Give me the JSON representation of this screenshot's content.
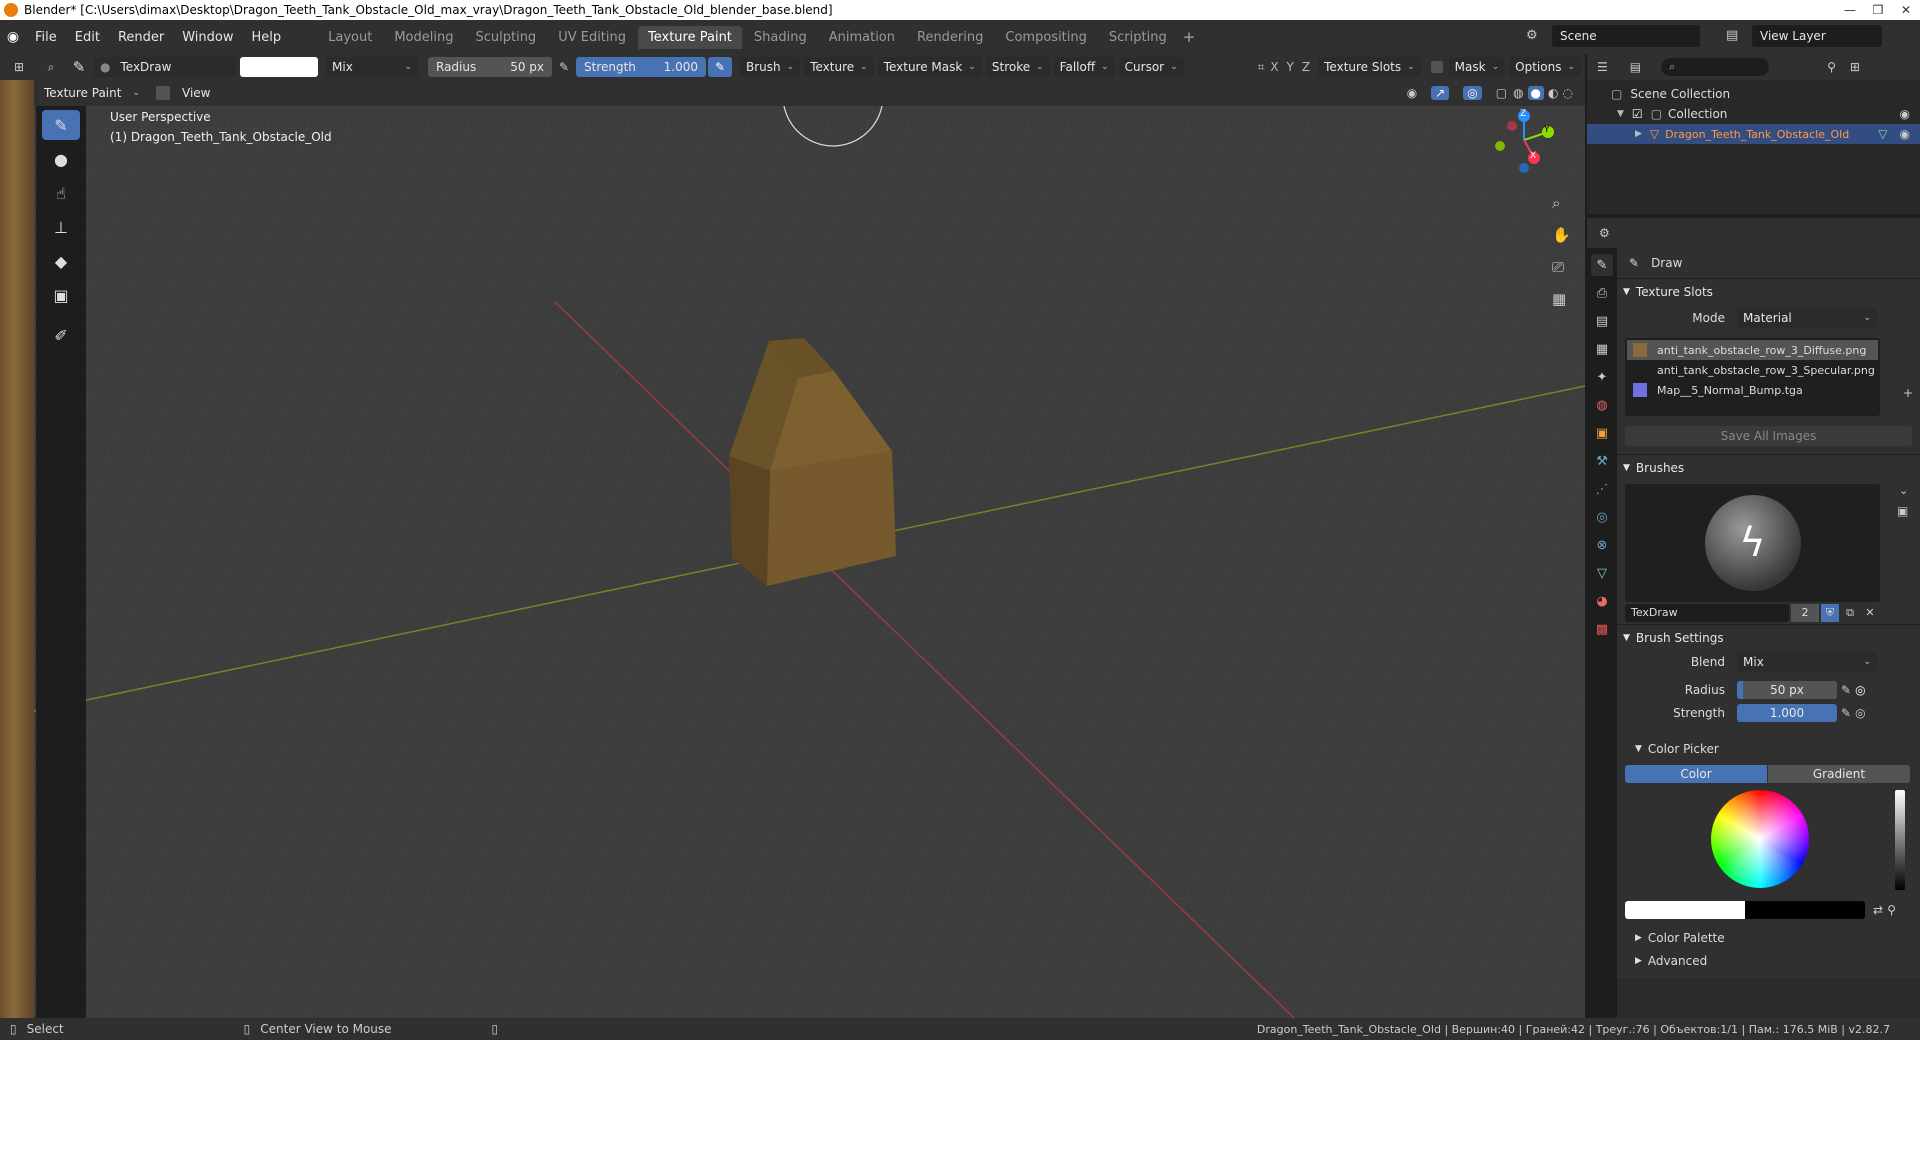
{
  "window": {
    "title": "Blender* [C:\\Users\\dimax\\Desktop\\Dragon_Teeth_Tank_Obstacle_Old_max_vray\\Dragon_Teeth_Tank_Obstacle_Old_blender_base.blend]",
    "buttons": [
      "—",
      "❐",
      "✕"
    ]
  },
  "menu": [
    "File",
    "Edit",
    "Render",
    "Window",
    "Help"
  ],
  "workspaces": [
    "Layout",
    "Modeling",
    "Sculpting",
    "UV Editing",
    "Texture Paint",
    "Shading",
    "Animation",
    "Rendering",
    "Compositing",
    "Scripting"
  ],
  "active_workspace": "Texture Paint",
  "scene": {
    "label": "Scene",
    "view_layer": "View Layer"
  },
  "header": {
    "brush_name": "TexDraw",
    "blend": "Mix",
    "radius_label": "Radius",
    "radius_value": "50 px",
    "strength_label": "Strength",
    "strength_value": "1.000",
    "menus": [
      "Brush",
      "Texture",
      "Texture Mask",
      "Stroke",
      "Falloff",
      "Cursor"
    ],
    "axes": [
      "X",
      "Y",
      "Z"
    ],
    "texture_slots": "Texture Slots",
    "mask": "Mask",
    "options": "Options"
  },
  "subheader": {
    "mode": "Texture Paint",
    "view": "View"
  },
  "viewport": {
    "perspective": "User Perspective",
    "object_label": "(1) Dragon_Teeth_Tank_Obstacle_Old",
    "gizmo": {
      "x": "X",
      "y": "Y",
      "z": "Z"
    }
  },
  "outliner": {
    "root": "Scene Collection",
    "collection": "Collection",
    "object": "Dragon_Teeth_Tank_Obstacle_Old"
  },
  "properties": {
    "tool": "Draw",
    "texture_slots": {
      "title": "Texture Slots",
      "mode_label": "Mode",
      "mode_value": "Material",
      "items": [
        "anti_tank_obstacle_row_3_Diffuse.png",
        "anti_tank_obstacle_row_3_Specular.png",
        "Map__5_Normal_Bump.tga"
      ],
      "save_all": "Save All Images"
    },
    "brushes": {
      "title": "Brushes",
      "name": "TexDraw",
      "users": "2"
    },
    "brush_settings": {
      "title": "Brush Settings",
      "blend_label": "Blend",
      "blend_value": "Mix",
      "radius_label": "Radius",
      "radius_value": "50 px",
      "strength_label": "Strength",
      "strength_value": "1.000"
    },
    "color_picker": {
      "title": "Color Picker",
      "tab_color": "Color",
      "tab_gradient": "Gradient"
    },
    "color_palette": "Color Palette",
    "advanced": "Advanced"
  },
  "status": {
    "select": "Select",
    "center": "Center View to Mouse",
    "info": "Dragon_Teeth_Tank_Obstacle_Old | Вершин:40 | Граней:42 | Треуг.:76 | Объектов:1/1 | Пам.: 176.5 MiB | v2.82.7"
  },
  "colors": {
    "accent": "#4772b3",
    "selected_text": "#ff9a42",
    "x_axis": "#ff3352",
    "y_axis": "#8bdc00",
    "z_axis": "#2890ff"
  }
}
